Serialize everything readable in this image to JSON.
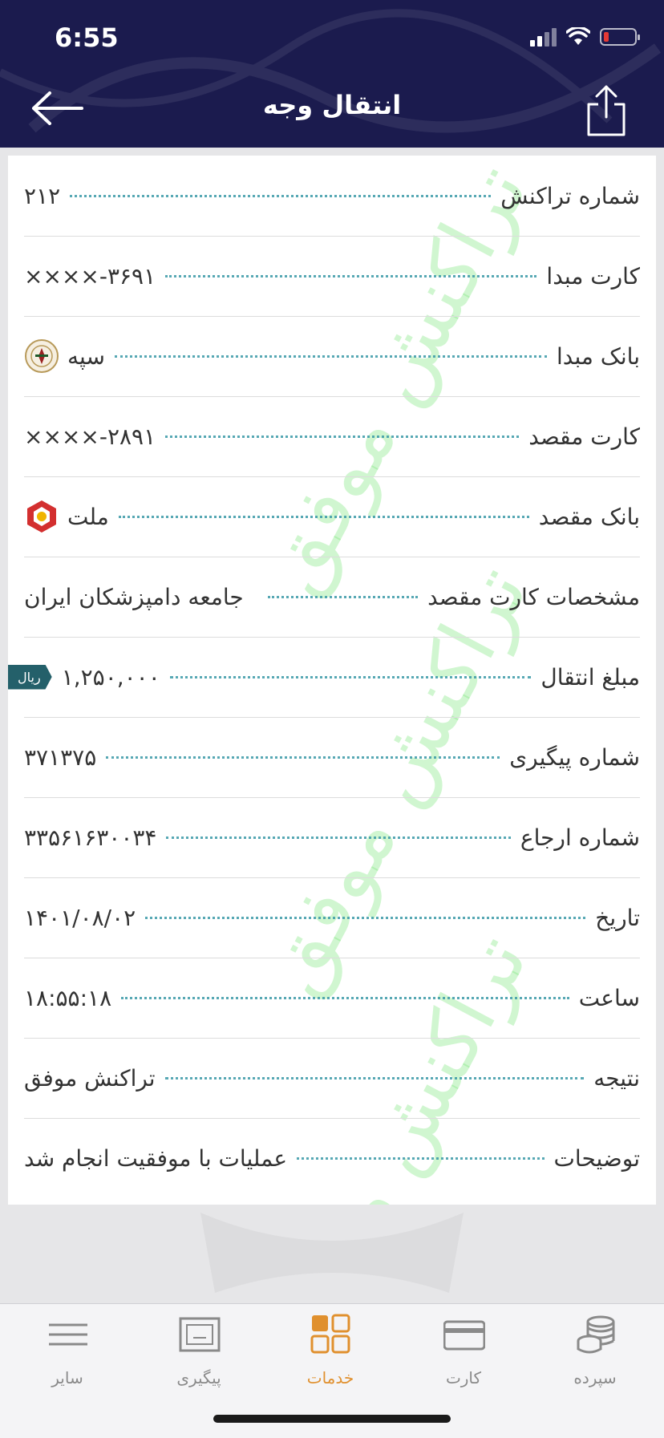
{
  "status_bar": {
    "time": "6:55"
  },
  "header": {
    "title": "انتقال وجه"
  },
  "watermark_text": "تراکنش موفق",
  "details": [
    {
      "label": "شماره تراکنش",
      "value": "۲۱۲"
    },
    {
      "label": "کارت مبدا",
      "value": "××××-۳۶۹۱"
    },
    {
      "label": "بانک مبدا",
      "value": "سپه",
      "icon": "sepah-bank-logo"
    },
    {
      "label": "کارت مقصد",
      "value": "××××-۲۸۹۱"
    },
    {
      "label": "بانک مقصد",
      "value": "ملت",
      "icon": "mellat-bank-logo"
    },
    {
      "label": "مشخصات کارت مقصد",
      "value": "جامعه دامپزشکان ایران"
    },
    {
      "label": "مبلغ انتقال",
      "value": "۱,۲۵۰,۰۰۰",
      "currency": "ریال"
    },
    {
      "label": "شماره پیگیری",
      "value": "۳۷۱۳۷۵"
    },
    {
      "label": "شماره ارجاع",
      "value": "۳۳۵۶۱۶۳۰۰۳۴"
    },
    {
      "label": "تاریخ",
      "value": "۱۴۰۱/۰۸/۰۲"
    },
    {
      "label": "ساعت",
      "value": "۱۸:۵۵:۱۸"
    },
    {
      "label": "نتیجه",
      "value": "تراکنش موفق"
    },
    {
      "label": "توضیحات",
      "value": "عملیات با موفقیت انجام شد"
    }
  ],
  "tabs": [
    {
      "label": "سایر",
      "icon": "menu-icon",
      "active": false
    },
    {
      "label": "پیگیری",
      "icon": "tracking-icon",
      "active": false
    },
    {
      "label": "خدمات",
      "icon": "services-grid-icon",
      "active": true
    },
    {
      "label": "کارت",
      "icon": "card-icon",
      "active": false
    },
    {
      "label": "سپرده",
      "icon": "coins-icon",
      "active": false
    }
  ],
  "colors": {
    "header_bg": "#1b1b4e",
    "dotted_leader": "#3a9aa8",
    "active_tab": "#e0902e",
    "currency_tag": "#24606a",
    "watermark": "#78e678"
  }
}
